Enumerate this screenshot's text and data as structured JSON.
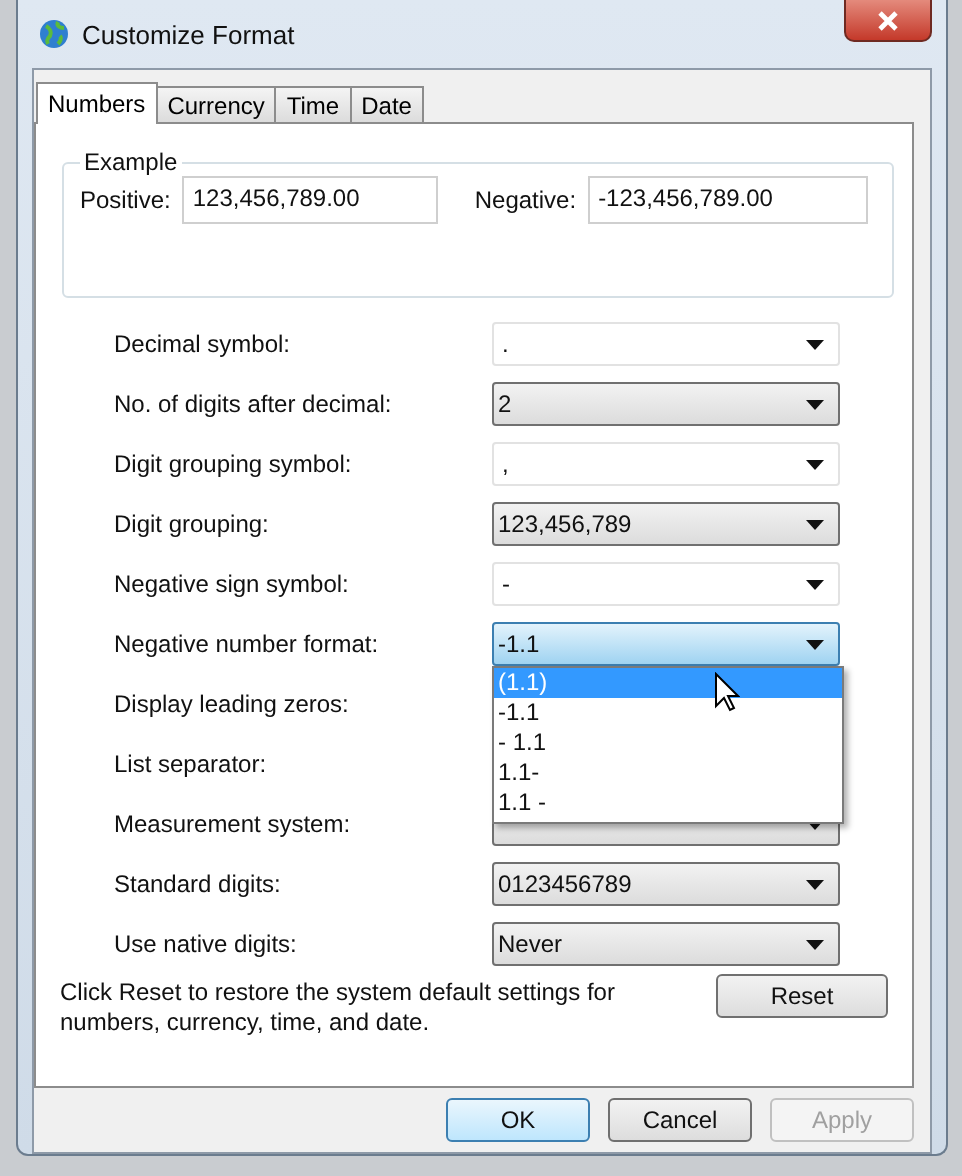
{
  "window": {
    "title": "Customize Format"
  },
  "tabs": [
    {
      "label": "Numbers",
      "selected": true
    },
    {
      "label": "Currency",
      "selected": false
    },
    {
      "label": "Time",
      "selected": false
    },
    {
      "label": "Date",
      "selected": false
    }
  ],
  "example": {
    "title": "Example",
    "positive_label": "Positive:",
    "positive_value": "123,456,789.00",
    "negative_label": "Negative:",
    "negative_value": "-123,456,789.00"
  },
  "settings": [
    {
      "label": "Decimal symbol:",
      "kind": "combo",
      "value": "."
    },
    {
      "label": "No. of digits after decimal:",
      "kind": "select",
      "value": "2"
    },
    {
      "label": "Digit grouping symbol:",
      "kind": "combo",
      "value": ","
    },
    {
      "label": "Digit grouping:",
      "kind": "select",
      "value": "123,456,789"
    },
    {
      "label": "Negative sign symbol:",
      "kind": "combo",
      "value": "-"
    },
    {
      "label": "Negative number format:",
      "kind": "open_select",
      "value": "-1.1"
    },
    {
      "label": "Display leading zeros:",
      "kind": "covered"
    },
    {
      "label": "List separator:",
      "kind": "covered"
    },
    {
      "label": "Measurement system:",
      "kind": "select"
    },
    {
      "label": "Standard digits:",
      "kind": "select",
      "value": "0123456789"
    },
    {
      "label": "Use native digits:",
      "kind": "select",
      "value": "Never"
    }
  ],
  "dropdown": {
    "items": [
      {
        "label": "(1.1)",
        "selected": true
      },
      {
        "label": "-1.1",
        "selected": false
      },
      {
        "label": "- 1.1",
        "selected": false
      },
      {
        "label": "1.1-",
        "selected": false
      },
      {
        "label": "1.1 -",
        "selected": false
      }
    ]
  },
  "reset_note": "Click Reset to restore the system default settings for numbers, currency, time, and date.",
  "reset_button": "Reset",
  "buttons": [
    {
      "label": "OK",
      "default": true,
      "disabled": false
    },
    {
      "label": "Cancel",
      "default": false,
      "disabled": false
    },
    {
      "label": "Apply",
      "default": false,
      "disabled": true
    }
  ]
}
